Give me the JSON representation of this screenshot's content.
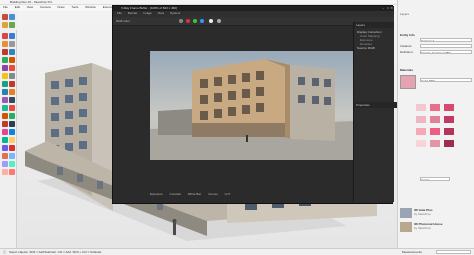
{
  "sketchup": {
    "title": "Building Rev-01 - SketchUp Pro",
    "menu": [
      "File",
      "Edit",
      "View",
      "Camera",
      "Draw",
      "Tools",
      "Window",
      "Extensions",
      "Help"
    ],
    "status_text": "Select objects. Shift = Add/Subtract. Ctrl = Add. Shift + Ctrl = Subtract.",
    "measurements_label": "Measurements"
  },
  "vfb": {
    "title": "V-Ray Frame Buffer - [100% of 823 x 460]",
    "menu": [
      "File",
      "Render",
      "Image",
      "View",
      "Options"
    ],
    "channel": "RGB color",
    "bottom_controls": [
      "Exposure",
      "Contrast",
      "White Bal.",
      "Curves",
      "LUT"
    ],
    "layers_header": "Layers",
    "layers": [
      "Display Correction",
      "Color Mapping",
      "Exposure",
      "Denoiser",
      "Source: RGB"
    ],
    "properties_label": "Properties"
  },
  "tray": {
    "tabs": [
      "Layers",
      "Entity Info",
      "Materials"
    ],
    "entity_label": "Entity Info",
    "layer_field": "Untagged",
    "instance_label": "Instance:",
    "definition_label": "Definition:",
    "definition_value": "Facade Apartment BD",
    "materials_label": "Materials",
    "material_name": "Color M03",
    "colors_label": "Colors",
    "info_items": [
      {
        "title": "3D Gate Plus",
        "sub": "by Sketchup"
      },
      {
        "title": "3D Photoreal House",
        "sub": "by Sketchup"
      }
    ]
  },
  "colors": {
    "swatches": [
      "#f3c7cf",
      "#e86f8a",
      "#d64a6f",
      "#efb5c0",
      "#e18097",
      "#c23b62",
      "#f5a9b7",
      "#ec5c83",
      "#b2355a",
      "#f8d4da",
      "#e693a6",
      "#9d2e4d"
    ]
  }
}
